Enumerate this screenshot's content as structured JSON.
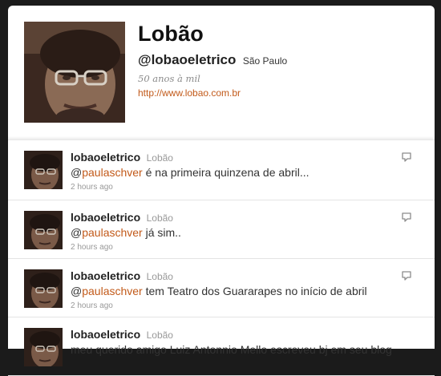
{
  "profile": {
    "name": "Lobão",
    "handle": "@lobaoeletrico",
    "location": "São Paulo",
    "bio": "50 anos à mil",
    "url": "http://www.lobao.com.br"
  },
  "tweets": [
    {
      "username": "lobaoeletrico",
      "fullname": "Lobão",
      "mention_prefix": "@",
      "mention": "paulaschver",
      "text": " é na primeira quinzena de abril...",
      "time": "2 hours ago"
    },
    {
      "username": "lobaoeletrico",
      "fullname": "Lobão",
      "mention_prefix": "@",
      "mention": "paulaschver",
      "text": " já sim..",
      "time": "2 hours ago"
    },
    {
      "username": "lobaoeletrico",
      "fullname": "Lobão",
      "mention_prefix": "@",
      "mention": "paulaschver",
      "text": " tem Teatro dos Guararapes no início de abril",
      "time": "2 hours ago"
    },
    {
      "username": "lobaoeletrico",
      "fullname": "Lobão",
      "mention_prefix": "",
      "mention": "",
      "text": "meu querido amigo Luiz Antonnio Mello escreveu bj em seu blog",
      "time": ""
    }
  ],
  "icons": {
    "reply": "reply-icon",
    "avatar": "profile-photo"
  }
}
